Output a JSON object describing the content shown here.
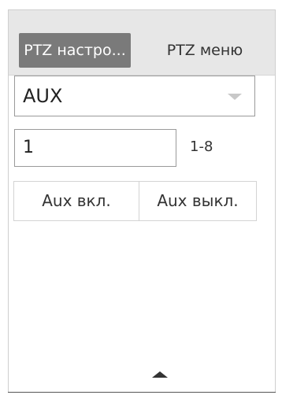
{
  "tabs": {
    "active_label": "PTZ настро...",
    "inactive_label": "PTZ меню"
  },
  "aux": {
    "select_value": "AUX",
    "number_value": "1",
    "range_label": "1-8",
    "on_label": "Aux вкл.",
    "off_label": "Aux выкл."
  },
  "icons": {
    "dropdown": "chevron-down-icon",
    "collapse": "chevron-up-icon"
  },
  "colors": {
    "active_tab_bg": "#7a7a7a",
    "tabbar_bg": "#e7e7e7"
  }
}
